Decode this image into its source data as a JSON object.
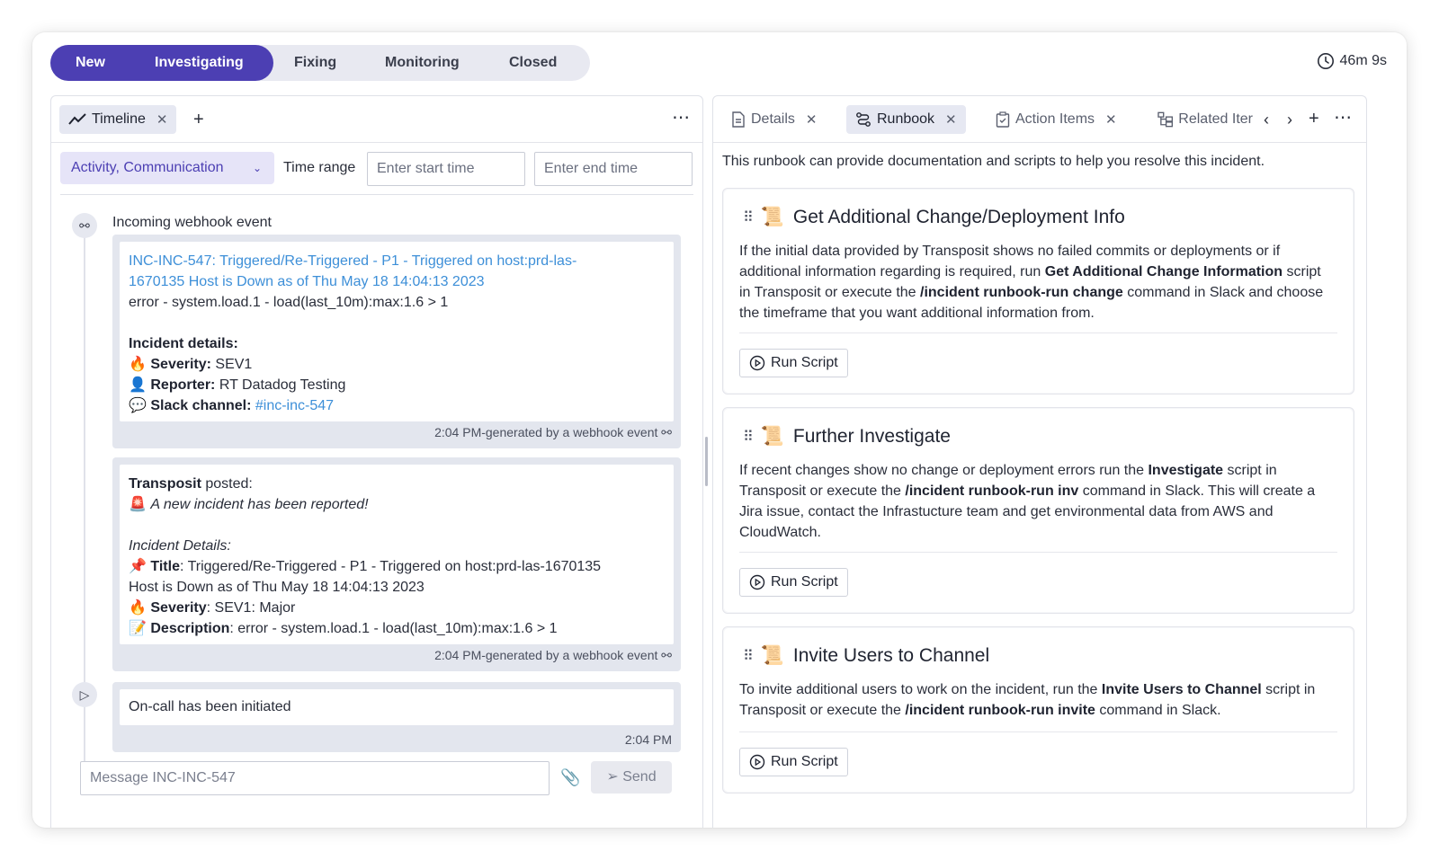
{
  "stages": {
    "new": "New",
    "investigating": "Investigating",
    "fixing": "Fixing",
    "monitoring": "Monitoring",
    "closed": "Closed"
  },
  "timer": "46m 9s",
  "left_tabs": {
    "timeline": "Timeline",
    "add": "+",
    "more": "⋯"
  },
  "filters": {
    "activity": "Activity, Communication",
    "time_range_label": "Time range",
    "start_placeholder": "Enter start time",
    "end_placeholder": "Enter end time"
  },
  "timeline": {
    "event1_title": "Incoming webhook event",
    "event1": {
      "link_line1": "INC-INC-547: Triggered/Re-Triggered - P1 - Triggered on host:prd-las-",
      "link_line2": "1670135 Host is Down as of Thu May 18 14:04:13 2023",
      "error": "error - system.load.1 - load(last_10m):max:1.6 > 1",
      "details_heading": "Incident details:",
      "severity_label": "Severity:",
      "severity_value": " SEV1",
      "reporter_label": "Reporter:",
      "reporter_value": " RT Datadog Testing",
      "slack_label": "Slack channel:",
      "slack_value": "#inc-inc-547",
      "footer": "2:04 PM-generated by a webhook event"
    },
    "event2": {
      "poster": "Transposit",
      "posted": " posted:",
      "announcement": "A new incident has been reported!",
      "details_heading": "Incident Details:",
      "title_label": "Title",
      "title_value": ": Triggered/Re-Triggered - P1 - Triggered on host:prd-las-1670135",
      "title_value2": "Host is Down as of Thu May 18 14:04:13 2023",
      "severity_label": "Severity",
      "severity_value": ": SEV1: Major",
      "description_label": "Description",
      "description_value": ": error - system.load.1 - load(last_10m):max:1.6 > 1",
      "footer": "2:04 PM-generated by a webhook event"
    },
    "event3": {
      "text": "On-call has been initiated",
      "footer": "2:04 PM"
    }
  },
  "composer": {
    "placeholder": "Message INC-INC-547",
    "send": "Send"
  },
  "right_tabs": {
    "details": "Details",
    "runbook": "Runbook",
    "action_items": "Action Items",
    "related": "Related Iter"
  },
  "runbook": {
    "intro": "This runbook can provide documentation and scripts to help you resolve this incident.",
    "run_label": "Run Script",
    "cards": [
      {
        "title": "Get Additional Change/Deployment Info",
        "t1": "If the initial data provided by Transposit shows no failed commits or deployments or if additional information regarding is required, run ",
        "b1": "Get Additional Change Information",
        "t2": " script in Transposit or execute the ",
        "b2": "/incident runbook-run change",
        "t3": " command in Slack and choose the timeframe that you want additional information from."
      },
      {
        "title": "Further Investigate",
        "t1": "If recent changes show no change or deployment errors run the ",
        "b1": "Investigate",
        "t2": " script in Transposit or execute the ",
        "b2": "/incident runbook-run inv",
        "t3": " command in Slack. This will create a Jira issue, contact the Infrastucture team and get environmental data from AWS and CloudWatch."
      },
      {
        "title": "Invite Users to Channel",
        "t1": "To invite additional users to work on the incident, run the ",
        "b1": "Invite Users to Channel",
        "t2": " script in Transposit or execute the ",
        "b2": "/incident runbook-run invite",
        "t3": " command in Slack."
      }
    ]
  },
  "colors": {
    "accent": "#4c3fb3",
    "link": "#3d8fd8"
  }
}
